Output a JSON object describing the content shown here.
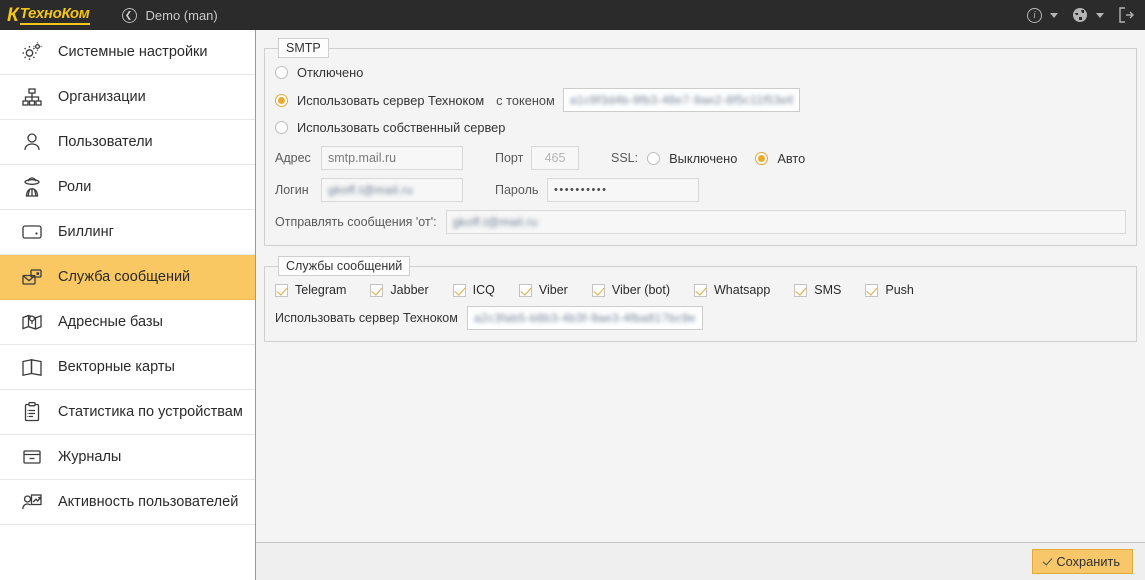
{
  "topbar": {
    "logo_initial": "К",
    "logo_text": "ТехноКом",
    "back_icon": "back-chevron-icon",
    "account_label": "Demo (man)",
    "info_icon": "info-icon",
    "globe_icon": "globe-icon",
    "logout_icon": "logout-icon",
    "info_glyph": "i",
    "globe_glyph": "⊕"
  },
  "sidebar": {
    "items": [
      {
        "label": "Системные настройки",
        "icon": "gears-icon",
        "active": false
      },
      {
        "label": "Организации",
        "icon": "org-chart-icon",
        "active": false
      },
      {
        "label": "Пользователи",
        "icon": "user-icon",
        "active": false
      },
      {
        "label": "Роли",
        "icon": "roles-icon",
        "active": false
      },
      {
        "label": "Биллинг",
        "icon": "wallet-icon",
        "active": false
      },
      {
        "label": "Служба сообщений",
        "icon": "messages-icon",
        "active": true
      },
      {
        "label": "Адресные базы",
        "icon": "map-pin-icon",
        "active": false
      },
      {
        "label": "Векторные карты",
        "icon": "map-icon",
        "active": false
      },
      {
        "label": "Статистика по устройствам",
        "icon": "clipboard-icon",
        "active": false
      },
      {
        "label": "Журналы",
        "icon": "archive-icon",
        "active": false
      },
      {
        "label": "Активность пользователей",
        "icon": "user-activity-icon",
        "active": false
      }
    ]
  },
  "smtp": {
    "legend": "SMTP",
    "mode_options": [
      {
        "label": "Отключено",
        "selected": false
      },
      {
        "label": "Использовать сервер Техноком",
        "selected": true
      },
      {
        "label": "Использовать собственный сервер",
        "selected": false
      }
    ],
    "token_label": "с токеном",
    "token_value": "a1c9f3d4b-9fb3-48e7-9ae2-8f5c11f53e6d",
    "address_label": "Адрес",
    "address_value": "smtp.mail.ru",
    "port_label": "Порт",
    "port_value": "465",
    "ssl_label": "SSL:",
    "ssl_options": [
      {
        "label": "Выключено",
        "selected": false
      },
      {
        "label": "Авто",
        "selected": true
      }
    ],
    "login_label": "Логин",
    "login_value": "gkoff.t@mail.ru",
    "password_label": "Пароль",
    "password_value": "••••••••••",
    "from_label": "Отправлять сообщения 'от':",
    "from_value": "gkoff.t@mail.ru"
  },
  "services": {
    "legend": "Службы сообщений",
    "items": [
      {
        "label": "Telegram",
        "checked": true
      },
      {
        "label": "Jabber",
        "checked": true
      },
      {
        "label": "ICQ",
        "checked": true
      },
      {
        "label": "Viber",
        "checked": true
      },
      {
        "label": "Viber (bot)",
        "checked": true
      },
      {
        "label": "Whatsapp",
        "checked": true
      },
      {
        "label": "SMS",
        "checked": true
      },
      {
        "label": "Push",
        "checked": true
      }
    ],
    "server_label": "Использовать сервер Техноком",
    "server_value": "a2c3fab5-b8b3-4b3f-9ae3-4fba817bc9e3"
  },
  "footer": {
    "save_label": "Сохранить",
    "save_icon": "check-icon"
  },
  "colors": {
    "accent": "#f9c863",
    "accent_radio": "#eda92c",
    "topbar_bg": "#2b2b2b",
    "logo_yellow": "#f5c518",
    "content_bg": "#f4f4f4"
  }
}
